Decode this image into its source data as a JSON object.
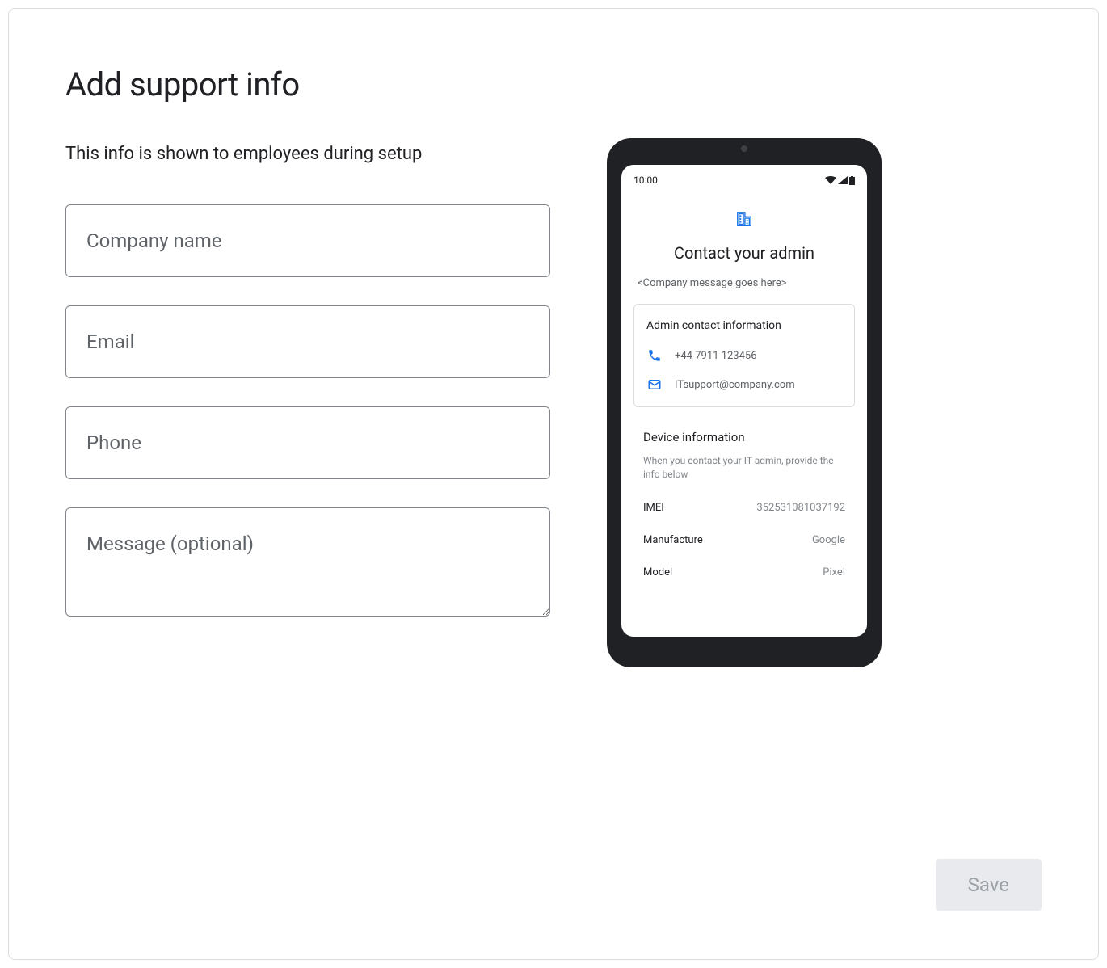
{
  "page": {
    "title": "Add support info",
    "subtitle": "This info is shown to employees during setup"
  },
  "form": {
    "company_placeholder": "Company name",
    "email_placeholder": "Email",
    "phone_placeholder": "Phone",
    "message_placeholder": "Message (optional)"
  },
  "preview": {
    "status_time": "10:00",
    "title": "Contact your admin",
    "company_message": "<Company message goes here>",
    "admin_card_title": "Admin contact information",
    "phone_value": "+44 7911 123456",
    "email_value": "ITsupport@company.com",
    "device_title": "Device information",
    "device_desc": "When you contact your IT admin, provide the info below",
    "imei_label": "IMEI",
    "imei_value": "352531081037192",
    "manufacture_label": "Manufacture",
    "manufacture_value": "Google",
    "model_label": "Model",
    "model_value": "Pixel"
  },
  "actions": {
    "save_label": "Save"
  }
}
